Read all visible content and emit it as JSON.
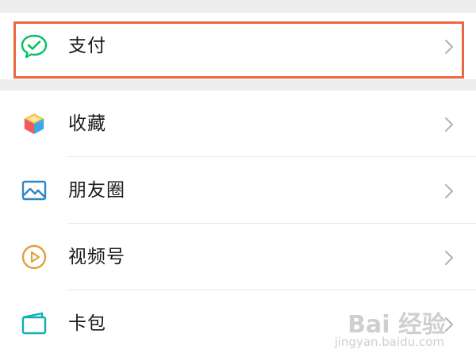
{
  "menu": {
    "items": [
      {
        "label": "支付",
        "icon": "wechat-pay-icon"
      },
      {
        "label": "收藏",
        "icon": "favorites-cube-icon"
      },
      {
        "label": "朋友圈",
        "icon": "moments-picture-icon"
      },
      {
        "label": "视频号",
        "icon": "channels-play-icon"
      },
      {
        "label": "卡包",
        "icon": "card-wallet-icon"
      }
    ]
  },
  "watermark": {
    "logo": "Bai 经验",
    "domain": "jingyan.baidu.com"
  },
  "colors": {
    "highlight_border": "#e8693f",
    "pay_green": "#07c160",
    "moments_blue": "#2f85c8",
    "channels_orange": "#e0a03a",
    "card_teal": "#10aeb5"
  }
}
